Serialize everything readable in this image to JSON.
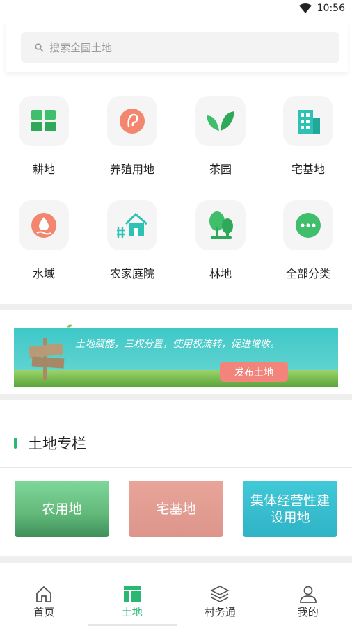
{
  "status": {
    "time": "10:56"
  },
  "search": {
    "placeholder": "搜索全国土地"
  },
  "categories": [
    {
      "label": "耕地",
      "icon": "farmland-grid-icon"
    },
    {
      "label": "养殖用地",
      "icon": "breeding-ear-icon"
    },
    {
      "label": "茶园",
      "icon": "tea-leaf-icon"
    },
    {
      "label": "宅基地",
      "icon": "building-icon"
    },
    {
      "label": "水域",
      "icon": "water-drop-icon"
    },
    {
      "label": "农家庭院",
      "icon": "house-fence-icon"
    },
    {
      "label": "林地",
      "icon": "tree-icon"
    },
    {
      "label": "全部分类",
      "icon": "more-dots-icon"
    }
  ],
  "banner": {
    "slogan": "土地赋能，三权分置，使用权流转，促进增收。",
    "button": "发布土地"
  },
  "section": {
    "title": "土地专栏"
  },
  "columns": [
    {
      "label": "农用地"
    },
    {
      "label": "宅基地"
    },
    {
      "label": "集体经营性建设用地"
    }
  ],
  "tabs": [
    {
      "label": "首页",
      "icon": "home-icon",
      "active": false
    },
    {
      "label": "土地",
      "icon": "land-layout-icon",
      "active": true
    },
    {
      "label": "村务通",
      "icon": "layers-icon",
      "active": false
    },
    {
      "label": "我的",
      "icon": "user-icon",
      "active": false
    }
  ],
  "colors": {
    "accent": "#2bb673",
    "banner_button": "#f3847b",
    "card_farm": "#61b879",
    "card_homestead": "#dc958a",
    "card_collective": "#2fb3c6"
  }
}
